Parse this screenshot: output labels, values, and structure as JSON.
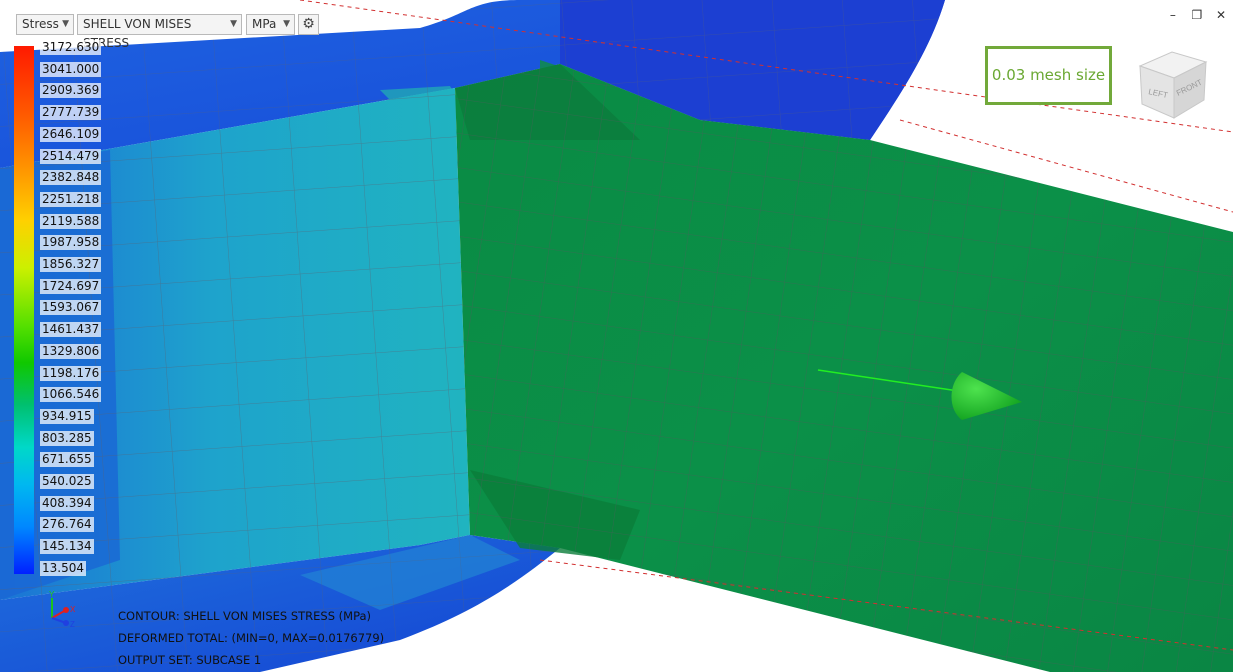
{
  "toolbar": {
    "result_type": "Stress",
    "result_component": "SHELL VON MISES STRESS",
    "unit": "MPa",
    "settings_icon": "gear-icon"
  },
  "legend": {
    "values": [
      "3172.630",
      "3041.000",
      "2909.369",
      "2777.739",
      "2646.109",
      "2514.479",
      "2382.848",
      "2251.218",
      "2119.588",
      "1987.958",
      "1856.327",
      "1724.697",
      "1593.067",
      "1461.437",
      "1329.806",
      "1198.176",
      "1066.546",
      "934.915",
      "803.285",
      "671.655",
      "540.025",
      "408.394",
      "276.764",
      "145.134",
      "13.504"
    ]
  },
  "info": {
    "contour": "CONTOUR: SHELL VON MISES STRESS (MPa)",
    "deformed": "DEFORMED TOTAL: (MIN=0, MAX=0.0176779)",
    "output_set": "OUTPUT SET: SUBCASE 1"
  },
  "annotation": {
    "label": "0.03 mesh size"
  },
  "view_cube": {
    "left": "LEFT",
    "front": "FRONT"
  },
  "triad": {
    "x": "X",
    "y": "Y",
    "z": "Z"
  },
  "colors": {
    "mesh_box_border": "#72a93a",
    "mesh_box_text": "#6aa832",
    "plate_green": "#0b8f45",
    "flange_blue": "#1244d8",
    "web_cyan": "#1ea8c8"
  }
}
